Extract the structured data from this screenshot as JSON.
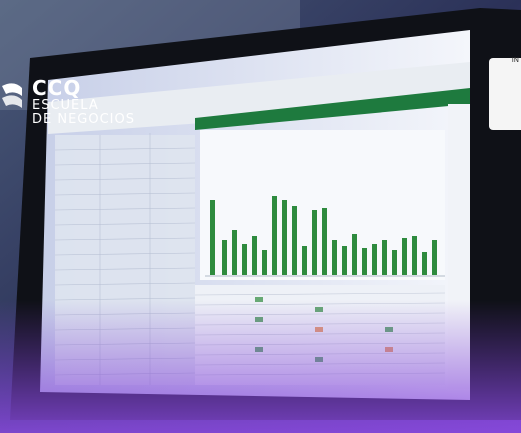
{
  "brand": {
    "name": "CCQ",
    "line1": "ESCUELA",
    "line2": "DE NEGOCIOS"
  },
  "corner_badge": {
    "text": "IN"
  },
  "colors": {
    "background": "#2a2f5c",
    "spreadsheet_ribbon": "#1e7a3e",
    "chart_bars": "#2e8b3e",
    "brand_text": "#ffffff"
  },
  "scene": {
    "subject": "computer monitor showing a spreadsheet with a green bar chart"
  }
}
